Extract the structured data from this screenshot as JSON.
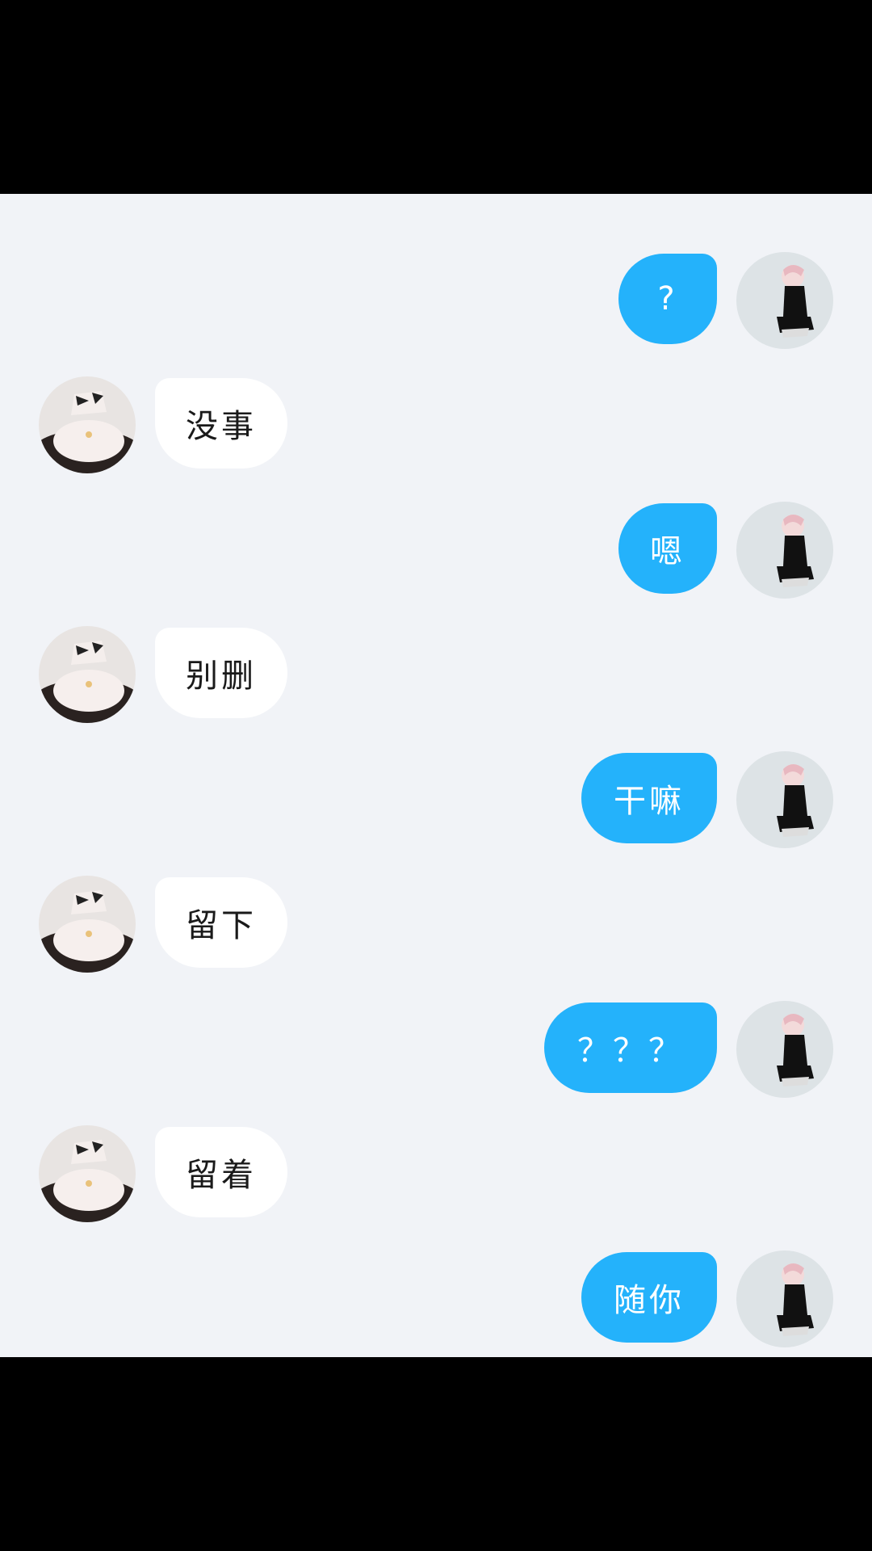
{
  "messages": [
    {
      "side": "out",
      "text": "?"
    },
    {
      "side": "in",
      "text": "没事"
    },
    {
      "side": "out",
      "text": "嗯"
    },
    {
      "side": "in",
      "text": "别删"
    },
    {
      "side": "out",
      "text": "干嘛"
    },
    {
      "side": "in",
      "text": "留下"
    },
    {
      "side": "out",
      "text": "？？？"
    },
    {
      "side": "in",
      "text": "留着"
    },
    {
      "side": "out",
      "text": "随你"
    }
  ],
  "colors": {
    "background": "#f1f3f7",
    "outgoing_bubble": "#24b2fb",
    "incoming_bubble": "#ffffff",
    "letterbox": "#000000"
  },
  "icons": {
    "incoming_avatar": "avatar-figure-white-dress",
    "outgoing_avatar": "avatar-figure-black-outfit"
  }
}
